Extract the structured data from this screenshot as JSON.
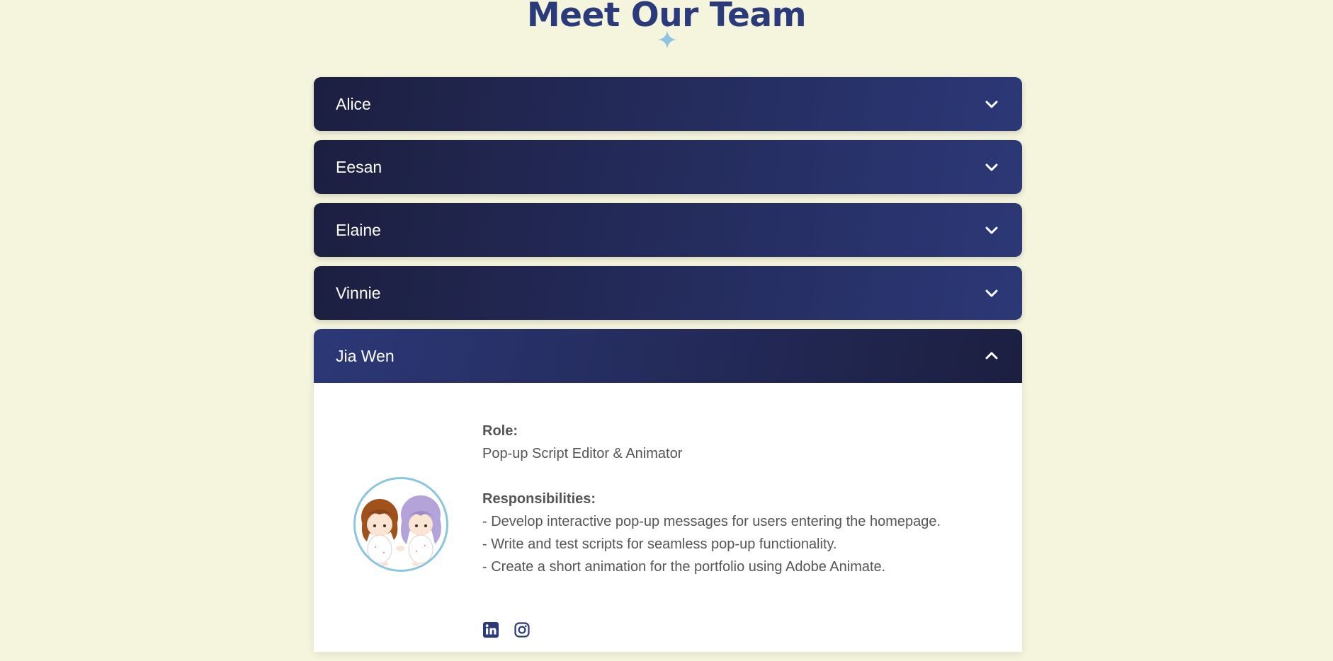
{
  "page": {
    "title": "Meet Our Team"
  },
  "members": [
    {
      "name": "Alice"
    },
    {
      "name": "Eesan"
    },
    {
      "name": "Elaine"
    },
    {
      "name": "Vinnie"
    },
    {
      "name": "Jia Wen"
    }
  ],
  "expanded": {
    "role_label": "Role:",
    "role": "Pop-up Script Editor & Animator",
    "responsibilities_label": "Responsibilities:",
    "responsibilities": [
      "- Develop interactive pop-up messages for users entering the homepage.",
      "- Write and test scripts for seamless pop-up functionality.",
      "- Create a short animation for the portfolio using Adobe Animate."
    ]
  },
  "icons": {
    "title_decoration": "sparkle-icon",
    "collapsed": "chevron-down-icon",
    "expanded": "chevron-up-icon",
    "social": [
      "linkedin-icon",
      "instagram-icon"
    ]
  },
  "colors": {
    "background": "#f5f4dc",
    "title": "#2b3a7a",
    "header_dark": "#1c1f40",
    "header_light": "#2c3877",
    "avatar_ring": "#8cc5e0",
    "sparkle": "#8fc3e3"
  }
}
